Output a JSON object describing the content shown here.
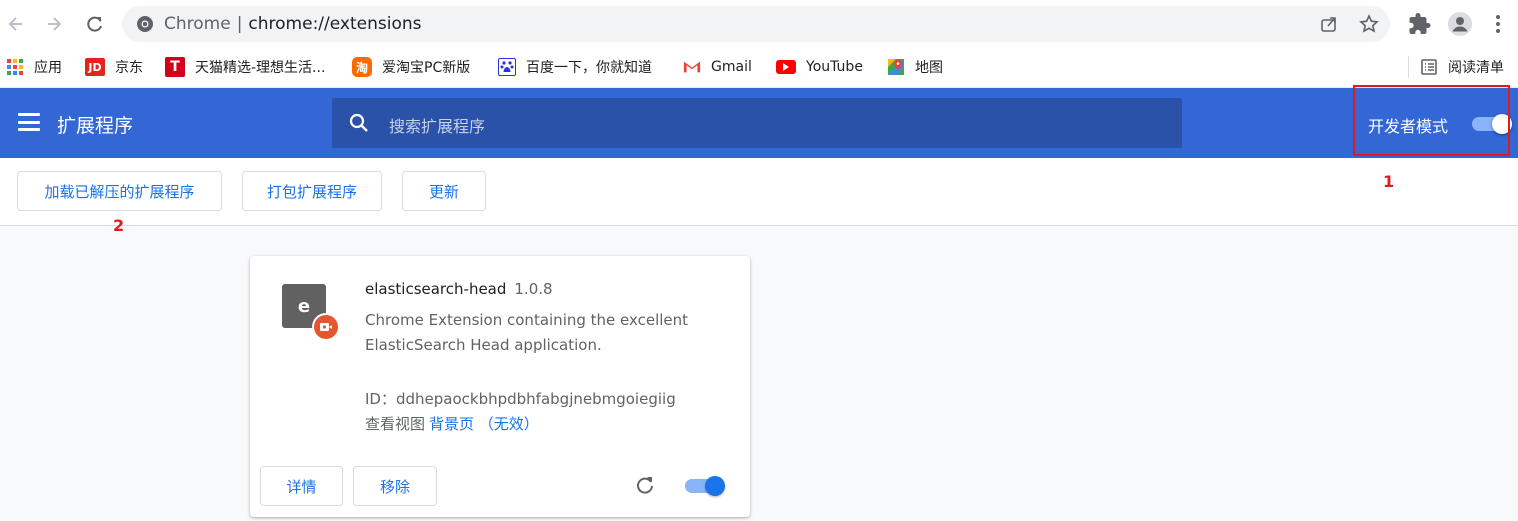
{
  "browser": {
    "address_prefix": "Chrome",
    "address_url": "chrome://extensions"
  },
  "bookmarks": [
    {
      "label": "应用",
      "icon": "apps-grid-icon"
    },
    {
      "label": "京东",
      "icon": "jd-icon"
    },
    {
      "label": "天猫精选-理想生活...",
      "icon": "tmall-icon"
    },
    {
      "label": "爱淘宝PC新版",
      "icon": "aitaobao-icon"
    },
    {
      "label": "百度一下，你就知道",
      "icon": "baidu-icon"
    },
    {
      "label": "Gmail",
      "icon": "gmail-icon"
    },
    {
      "label": "YouTube",
      "icon": "youtube-icon"
    },
    {
      "label": "地图",
      "icon": "maps-icon"
    }
  ],
  "reading_list": "阅读清单",
  "header": {
    "title": "扩展程序",
    "search_placeholder": "搜索扩展程序",
    "dev_mode_label": "开发者模式",
    "dev_mode_on": true
  },
  "actions": {
    "load_unpacked": "加载已解压的扩展程序",
    "pack": "打包扩展程序",
    "update": "更新"
  },
  "annotations": {
    "one": "1",
    "two": "2"
  },
  "extension": {
    "icon_letter": "e",
    "name": "elasticsearch-head",
    "version": "1.0.8",
    "description": "Chrome Extension containing the excellent ElasticSearch Head application.",
    "id_label": "ID：",
    "id_value": "ddhepaockbhpdbhfabgjnebmgoiegiig",
    "inspect_label": "查看视图",
    "inspect_link": "背景页 （无效）",
    "details_button": "详情",
    "remove_button": "移除",
    "enabled": true
  },
  "colors": {
    "header_blue": "#3367d6",
    "accent": "#1a73e8",
    "annotation_red": "#e01b1b"
  }
}
